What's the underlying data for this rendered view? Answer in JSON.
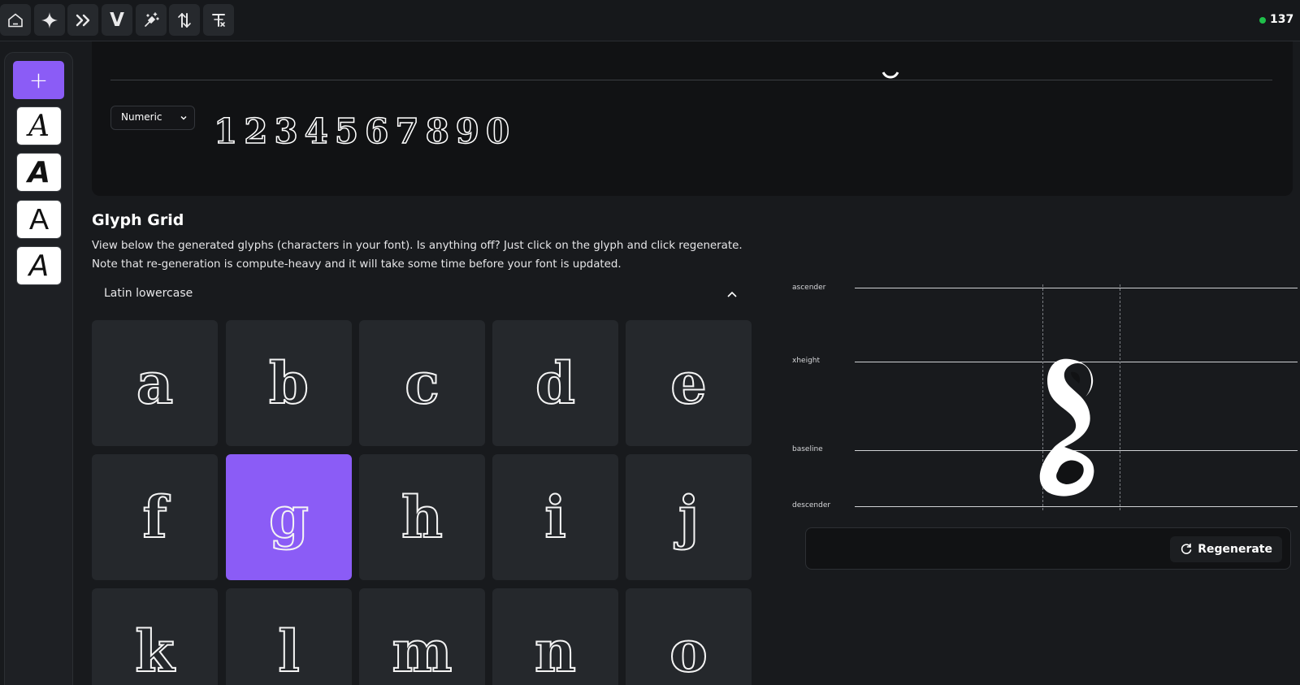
{
  "toolbar": {
    "tools": [
      {
        "name": "home-icon"
      },
      {
        "name": "sparkle-icon"
      },
      {
        "name": "double-chevron-right-icon"
      },
      {
        "name": "letter-v-icon",
        "label": "V"
      },
      {
        "name": "magic-wand-icon"
      },
      {
        "name": "spacing-icon"
      },
      {
        "name": "text-format-icon"
      }
    ],
    "credits": "137"
  },
  "sidebar": {
    "add_label": "+",
    "fonts": [
      "A",
      "A",
      "A",
      "A"
    ]
  },
  "preview": {
    "charset_select": "Numeric",
    "numeric_sample": "1234567890"
  },
  "glyph_grid": {
    "title": "Glyph Grid",
    "description": "View below the generated glyphs (characters in your font). Is anything off? Just click on the glyph and click regenerate. Note that re-generation is compute-heavy and it will take some time before your font is updated.",
    "section_label": "Latin lowercase",
    "glyphs": [
      "a",
      "b",
      "c",
      "d",
      "e",
      "f",
      "g",
      "h",
      "i",
      "j",
      "k",
      "l",
      "m",
      "n",
      "o"
    ],
    "selected": "g"
  },
  "metrics": {
    "ascender_label": "ascender",
    "xheight_label": "xheight",
    "baseline_label": "baseline",
    "descender_label": "descender"
  },
  "actions": {
    "regenerate_label": "Regenerate"
  },
  "colors": {
    "accent": "#8b5cf6",
    "status_online": "#1fbf4a",
    "tile_bg": "#25282c"
  }
}
